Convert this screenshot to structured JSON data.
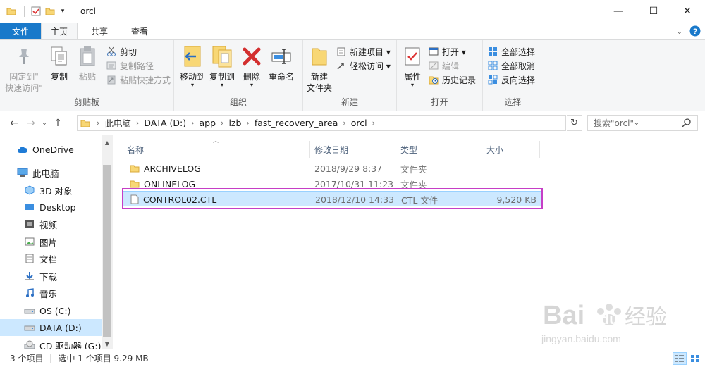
{
  "window": {
    "title": "orcl",
    "minimize": "—",
    "maximize": "☐",
    "close": "✕"
  },
  "tabs": {
    "file": "文件",
    "home": "主页",
    "share": "共享",
    "view": "查看"
  },
  "ribbon": {
    "clipboard": {
      "label": "剪贴板",
      "pin_line1": "固定到\"",
      "pin_line2": "快速访问\"",
      "copy": "复制",
      "paste": "粘贴",
      "cut": "剪切",
      "copy_path": "复制路径",
      "paste_shortcut": "粘贴快捷方式"
    },
    "organize": {
      "label": "组织",
      "move_to": "移动到",
      "copy_to": "复制到",
      "delete": "删除",
      "rename": "重命名"
    },
    "new": {
      "label": "新建",
      "new_folder_line1": "新建",
      "new_folder_line2": "文件夹",
      "new_item": "新建项目 ▾",
      "easy_access": "轻松访问 ▾"
    },
    "open": {
      "label": "打开",
      "properties": "属性",
      "open": "打开 ▾",
      "edit": "编辑",
      "history": "历史记录"
    },
    "select": {
      "label": "选择",
      "select_all": "全部选择",
      "select_none": "全部取消",
      "invert": "反向选择"
    }
  },
  "address": {
    "crumbs": [
      "此电脑",
      "DATA (D:)",
      "app",
      "lzb",
      "fast_recovery_area",
      "orcl"
    ],
    "search_placeholder": "搜索\"orcl\""
  },
  "nav": {
    "items": [
      {
        "label": "OneDrive",
        "icon": "cloud-icon"
      },
      {
        "label": "此电脑",
        "icon": "computer-icon"
      },
      {
        "label": "3D 对象",
        "icon": "cube-icon"
      },
      {
        "label": "Desktop",
        "icon": "desktop-icon"
      },
      {
        "label": "视频",
        "icon": "video-icon"
      },
      {
        "label": "图片",
        "icon": "picture-icon"
      },
      {
        "label": "文档",
        "icon": "document-icon"
      },
      {
        "label": "下载",
        "icon": "download-icon"
      },
      {
        "label": "音乐",
        "icon": "music-icon"
      },
      {
        "label": "OS (C:)",
        "icon": "drive-icon"
      },
      {
        "label": "DATA (D:)",
        "icon": "drive-icon"
      },
      {
        "label": "CD 驱动器 (G:)",
        "icon": "cd-drive-icon"
      }
    ]
  },
  "filelist": {
    "columns": {
      "name": "名称",
      "date": "修改日期",
      "type": "类型",
      "size": "大小"
    },
    "rows": [
      {
        "name": "ARCHIVELOG",
        "date": "2018/9/29 8:37",
        "type": "文件夹",
        "size": ""
      },
      {
        "name": "ONLINELOG",
        "date": "2017/10/31 11:23",
        "type": "文件夹",
        "size": ""
      },
      {
        "name": "CONTROL02.CTL",
        "date": "2018/12/10 14:33",
        "type": "CTL 文件",
        "size": "9,520 KB"
      }
    ]
  },
  "status": {
    "count": "3 个项目",
    "selection": "选中 1 个项目  9.29 MB"
  },
  "watermark": {
    "brand": "Bai",
    "brand2": "du",
    "cn": "经验",
    "url": "jingyan.baidu.com"
  },
  "colors": {
    "accent": "#1979ca",
    "selection": "#cce8ff",
    "highlight": "#c63ec6"
  }
}
